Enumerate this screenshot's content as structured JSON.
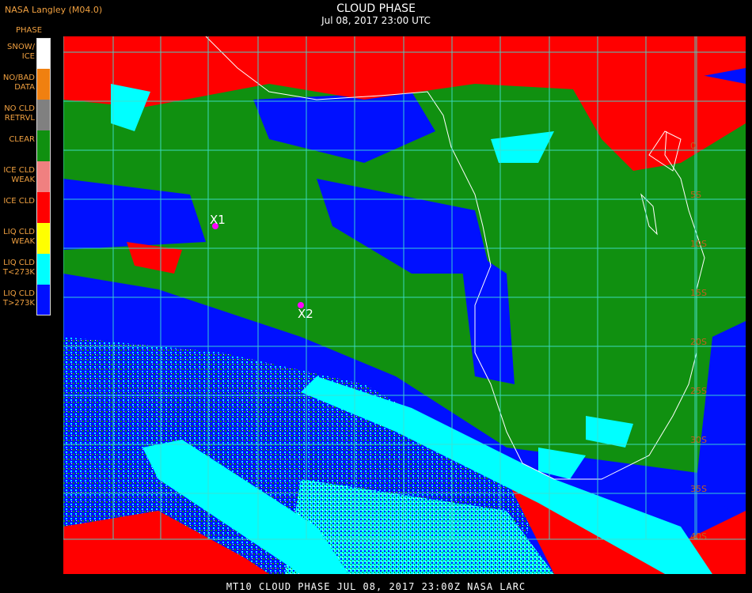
{
  "header": {
    "credit": "NASA Langley (M04.0)",
    "legend_title": "PHASE",
    "title": "CLOUD PHASE",
    "subtitle": "Jul 08, 2017 23:00 UTC"
  },
  "legend": [
    {
      "label": "SNOW/\nICE",
      "color": "#ffffff"
    },
    {
      "label": "NO/BAD\nDATA",
      "color": "#f08010"
    },
    {
      "label": "NO CLD\nRETRVL",
      "color": "#808080"
    },
    {
      "label": "CLEAR",
      "color": "#109010"
    },
    {
      "label": "ICE CLD\nWEAK",
      "color": "#f08080"
    },
    {
      "label": "ICE CLD",
      "color": "#ff0000"
    },
    {
      "label": "LIQ CLD\nWEAK",
      "color": "#ffff00"
    },
    {
      "label": "LIQ CLD\nT<273K",
      "color": "#00ffff"
    },
    {
      "label": "LIQ CLD\nT>273K",
      "color": "#0010ff"
    }
  ],
  "map": {
    "lat_labels": [
      "0",
      "5S",
      "10S",
      "15S",
      "20S",
      "25S",
      "30S",
      "35S",
      "40S"
    ],
    "markers": [
      {
        "label": "X1"
      },
      {
        "label": "X2"
      }
    ]
  },
  "footer": {
    "text": "MT10  CLOUD PHASE   JUL 08, 2017 23:00Z   NASA LARC"
  }
}
